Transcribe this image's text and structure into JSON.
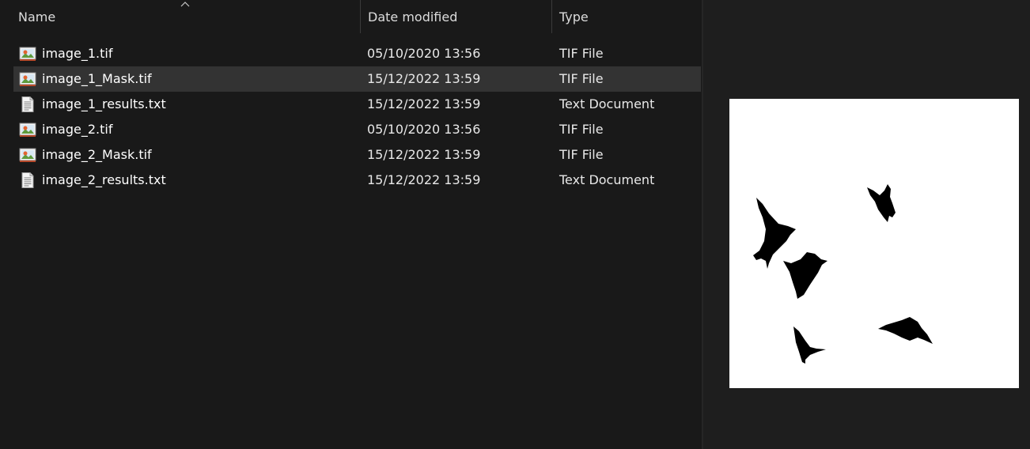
{
  "columns": {
    "name": "Name",
    "date_modified": "Date modified",
    "type": "Type"
  },
  "files": [
    {
      "name": "image_1.tif",
      "date": "05/10/2020 13:56",
      "type": "TIF File",
      "icon": "tif-image-icon",
      "selected": false
    },
    {
      "name": "image_1_Mask.tif",
      "date": "15/12/2022 13:59",
      "type": "TIF File",
      "icon": "tif-image-icon",
      "selected": true
    },
    {
      "name": "image_1_results.txt",
      "date": "15/12/2022 13:59",
      "type": "Text Document",
      "icon": "text-document-icon",
      "selected": false
    },
    {
      "name": "image_2.tif",
      "date": "05/10/2020 13:56",
      "type": "TIF File",
      "icon": "tif-image-icon",
      "selected": false
    },
    {
      "name": "image_2_Mask.tif",
      "date": "15/12/2022 13:59",
      "type": "TIF File",
      "icon": "tif-image-icon",
      "selected": false
    },
    {
      "name": "image_2_results.txt",
      "date": "15/12/2022 13:59",
      "type": "Text Document",
      "icon": "text-document-icon",
      "selected": false
    }
  ],
  "sort": {
    "column": "name",
    "direction": "ascending"
  },
  "preview": {
    "icon": "mask-preview-image"
  },
  "colors": {
    "background": "#191919",
    "selected_row": "#333333",
    "preview_background": "#ffffff",
    "mask_shapes": "#000000"
  }
}
